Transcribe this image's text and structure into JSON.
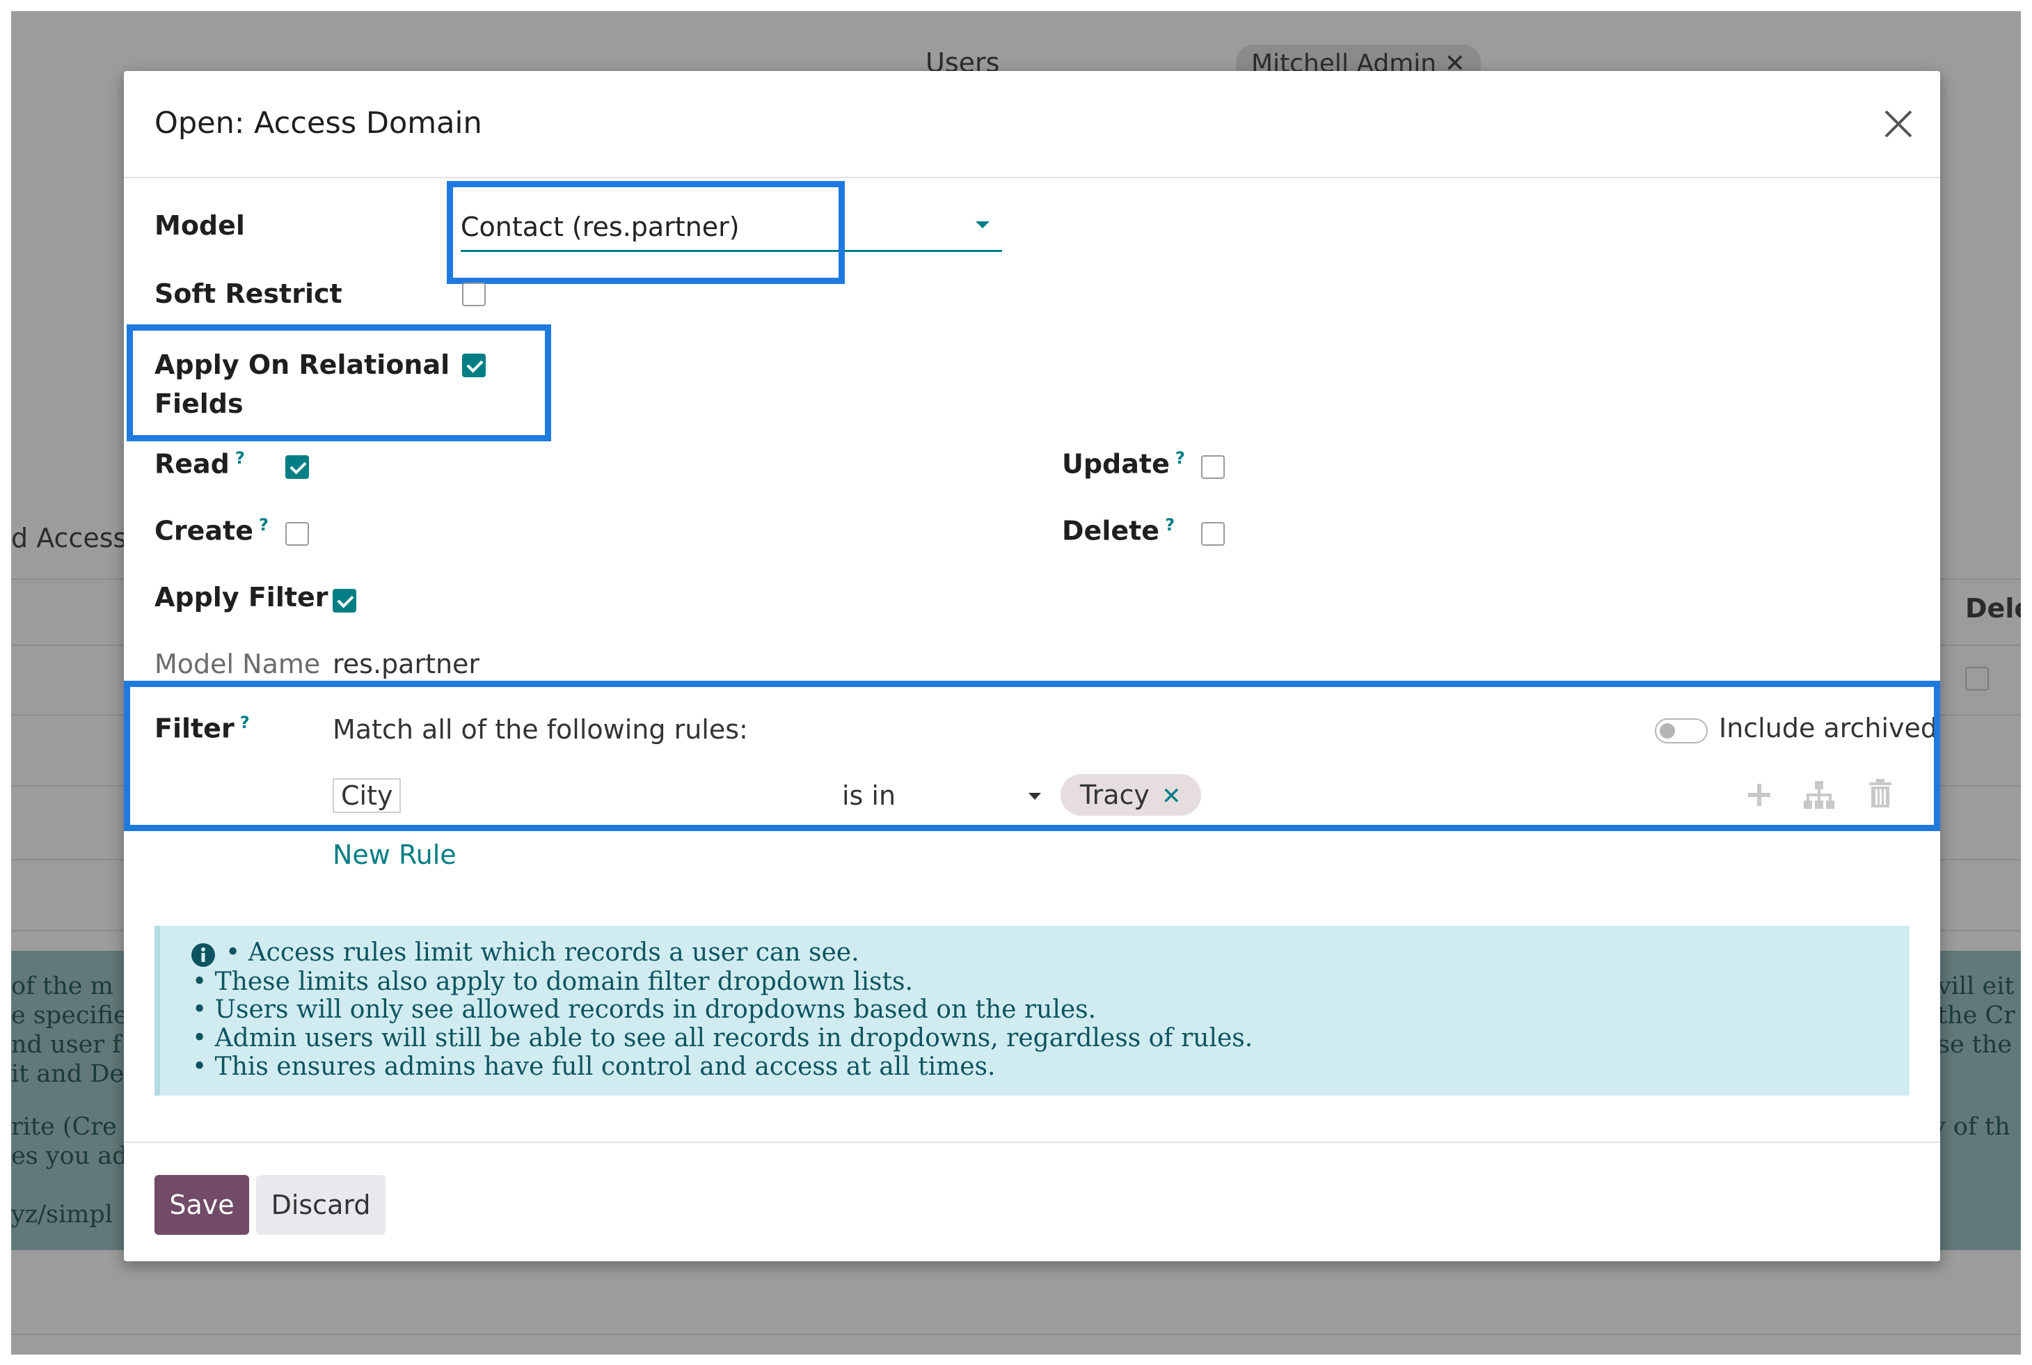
{
  "background": {
    "users_label": "Users",
    "user_tag": "Mitchell Admin",
    "access_label": "d Access",
    "dele_label": "Dele",
    "left_text": [
      "of the m",
      "e specifie",
      "nd user f",
      "it and De",
      "rite (Cre",
      "es you ad",
      "yz/simpl"
    ],
    "right_text": [
      "vill eit",
      "the Cr",
      "se the",
      "y of th"
    ]
  },
  "modal": {
    "title": "Open: Access Domain",
    "model": {
      "label": "Model",
      "value": "Contact (res.partner)"
    },
    "soft_restrict": {
      "label": "Soft Restrict",
      "checked": false
    },
    "apply_relational": {
      "label_line1": "Apply On Relational",
      "label_line2": "Fields",
      "checked": true
    },
    "read": {
      "label": "Read",
      "checked": true
    },
    "create": {
      "label": "Create",
      "checked": false
    },
    "update": {
      "label": "Update",
      "checked": false
    },
    "delete": {
      "label": "Delete",
      "checked": false
    },
    "apply_filter": {
      "label": "Apply Filter",
      "checked": true
    },
    "model_name": {
      "label": "Model Name",
      "value": "res.partner"
    },
    "filter": {
      "label": "Filter",
      "match_text": "Match all of the following rules:",
      "include_archived_label": "Include archived",
      "include_archived_on": false,
      "rule": {
        "field": "City",
        "operator": "is in",
        "value_tag": "Tracy"
      },
      "new_rule_label": "New Rule"
    },
    "help_marker": "?",
    "info_lines": [
      "• Access rules limit which records a user can see.",
      "• These limits also apply to domain filter dropdown lists.",
      "• Users will only see allowed records in dropdowns based on the rules.",
      "• Admin users will still be able to see all records in dropdowns, regardless of rules.",
      "• This ensures admins have full control and access at all times."
    ],
    "save_label": "Save",
    "discard_label": "Discard"
  },
  "colors": {
    "accent": "#017e84",
    "highlight": "#1f7ae0",
    "save_button": "#714b67",
    "info_bg": "#d1ecf1"
  }
}
